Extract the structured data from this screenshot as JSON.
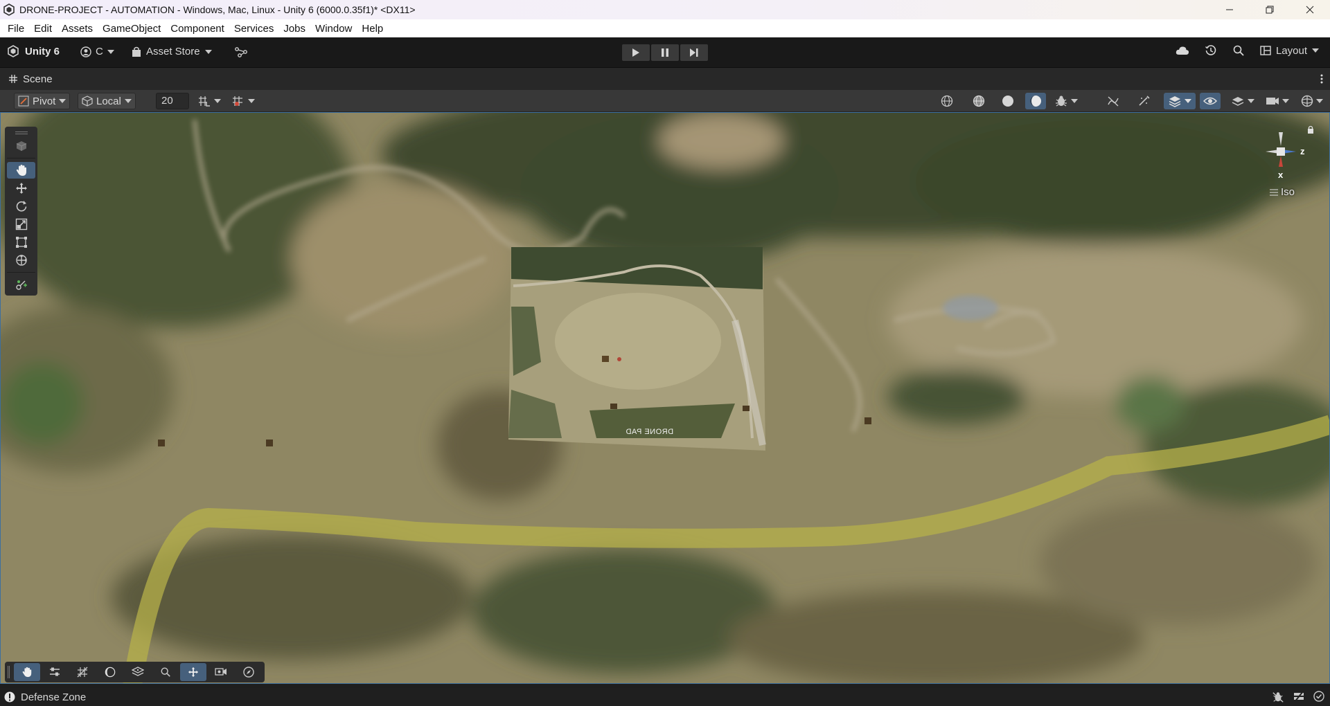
{
  "window": {
    "title": "DRONE-PROJECT - AUTOMATION - Windows, Mac, Linux - Unity 6 (6000.0.35f1)* <DX11>",
    "controls": [
      "minimize",
      "restore",
      "close"
    ]
  },
  "menu": [
    "File",
    "Edit",
    "Assets",
    "GameObject",
    "Component",
    "Services",
    "Jobs",
    "Window",
    "Help"
  ],
  "toolbar": {
    "product": "Unity 6",
    "account": "C",
    "asset_store": "Asset Store",
    "layout": "Layout"
  },
  "scene_tab": {
    "label": "Scene"
  },
  "scene_toolbar": {
    "pivot": "Pivot",
    "space": "Local",
    "grid_size": "20"
  },
  "viewport": {
    "gizmo_axes": {
      "x": "x",
      "z": "z"
    },
    "projection": "Iso",
    "map_label": "DRONE PAD"
  },
  "status": {
    "message": "Defense Zone"
  },
  "colors": {
    "accent": "#46607c",
    "viewport_border": "#3c6fa0",
    "path": "#b6b04a"
  }
}
